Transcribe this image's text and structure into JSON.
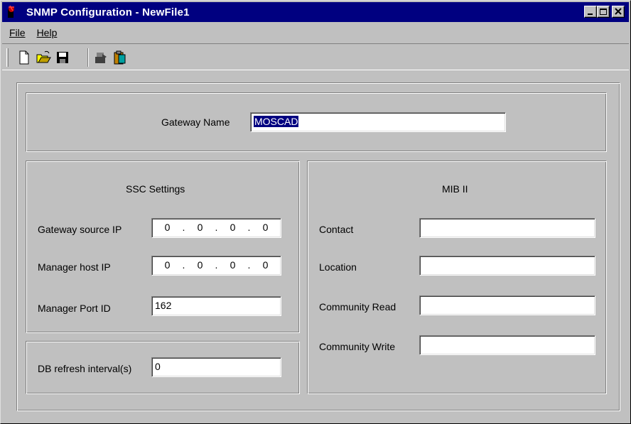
{
  "window": {
    "title": "SNMP Configuration - NewFile1",
    "controls": [
      "minimize-icon",
      "maximize-icon",
      "close-icon"
    ]
  },
  "menu": {
    "file": "File",
    "help": "Help"
  },
  "toolbar": {
    "tools": [
      "new-file-icon",
      "open-folder-icon",
      "save-disk-icon",
      "download-icon",
      "clipboard-icon"
    ]
  },
  "gateway": {
    "label": "Gateway Name",
    "value": "MOSCAD"
  },
  "ssc": {
    "title": "SSC Settings",
    "gateway_source_ip_label": "Gateway source IP",
    "gateway_source_ip": [
      "0",
      ".",
      "0",
      ".",
      "0",
      ".",
      "0"
    ],
    "manager_host_ip_label": "Manager host IP",
    "manager_host_ip": [
      "0",
      ".",
      "0",
      ".",
      "0",
      ".",
      "0"
    ],
    "manager_port_label": "Manager Port ID",
    "manager_port_value": "162"
  },
  "db": {
    "label": "DB refresh interval(s)",
    "value": "0"
  },
  "mib": {
    "title": "MIB II",
    "contact_label": "Contact",
    "contact_value": "",
    "location_label": "Location",
    "location_value": "",
    "community_read_label": "Community Read",
    "community_read_value": "",
    "community_write_label": "Community Write",
    "community_write_value": ""
  },
  "colors": {
    "titlebar": "#000080",
    "face": "#c0c0c0",
    "selection": "#000080"
  }
}
